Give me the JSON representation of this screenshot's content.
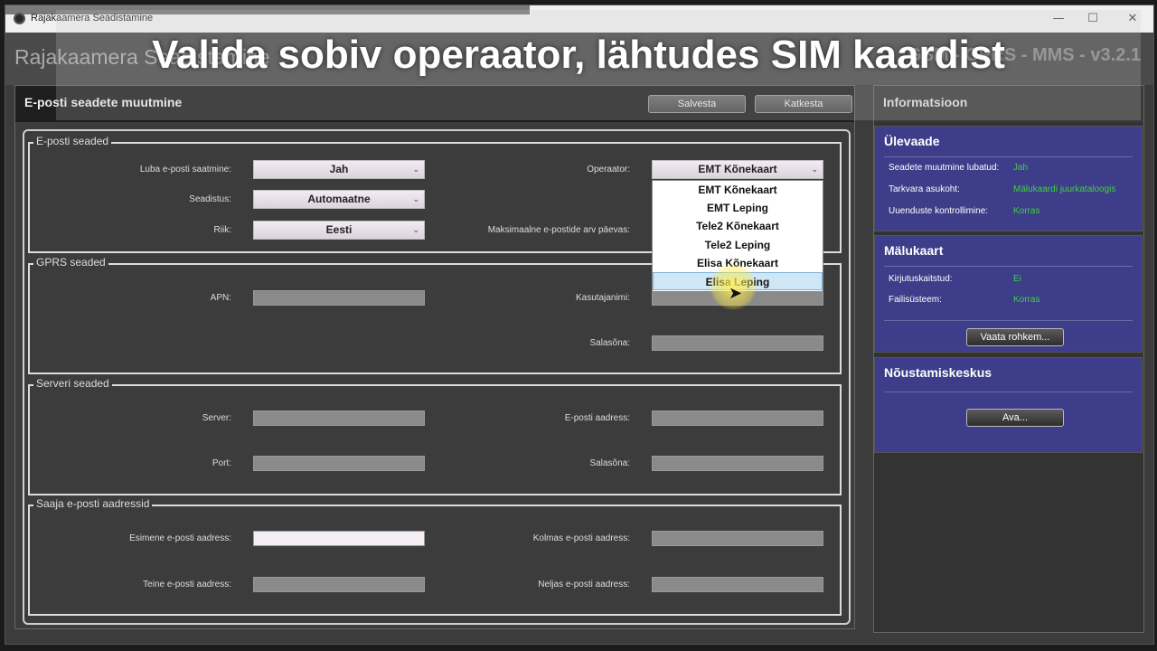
{
  "window": {
    "title": "Rajakaamera Seadistamine",
    "minimize": "—",
    "maximize": "☐",
    "close": "✕"
  },
  "header": {
    "app_title": "Rajakaamera Seadistamine",
    "version": "GSM - GPRS - MMS - v3.2.1"
  },
  "caption": "Valida sobiv operaator, lähtudes SIM kaardist",
  "email_panel": {
    "title": "E-posti seadete muutmine",
    "save_label": "Salvesta",
    "cancel_label": "Katkesta",
    "email_group": {
      "legend": "E-posti seaded",
      "enable_label": "Luba e-posti saatmine:",
      "enable_value": "Jah",
      "setup_label": "Seadistus:",
      "setup_value": "Automaatne",
      "country_label": "Riik:",
      "country_value": "Eesti",
      "operator_label": "Operaator:",
      "operator_value": "EMT Kõnekaart",
      "max_label": "Maksimaalne e-postide arv päevas:"
    },
    "operator_options": [
      "EMT Kõnekaart",
      "EMT Leping",
      "Tele2 Kõnekaart",
      "Tele2 Leping",
      "Elisa Kõnekaart",
      "Elisa Leping"
    ],
    "gprs_group": {
      "legend": "GPRS seaded",
      "apn_label": "APN:",
      "user_label": "Kasutajanimi:",
      "password_label": "Salasõna:"
    },
    "server_group": {
      "legend": "Serveri seaded",
      "server_label": "Server:",
      "email_label": "E-posti aadress:",
      "port_label": "Port:",
      "password_label": "Salasõna:"
    },
    "recipients_group": {
      "legend": "Saaja e-posti aadressid",
      "first_label": "Esimene e-posti aadress:",
      "third_label": "Kolmas e-posti aadress:",
      "second_label": "Teine e-posti aadress:",
      "fourth_label": "Neljas e-posti aadress:"
    }
  },
  "info_panel": {
    "title": "Informatsioon",
    "overview": {
      "heading": "Ülevaade",
      "rows": [
        {
          "label": "Seadete muutmine lubatud:",
          "value": "Jah"
        },
        {
          "label": "Tarkvara asukoht:",
          "value": "Mälukaardi juurkataloogis"
        },
        {
          "label": "Uuenduste kontrollimine:",
          "value": "Korras"
        }
      ]
    },
    "memory": {
      "heading": "Mälukaart",
      "rows": [
        {
          "label": "Kirjutuskaitstud:",
          "value": "Ei"
        },
        {
          "label": "Failisüsteem:",
          "value": "Korras"
        }
      ],
      "button": "Vaata rohkem..."
    },
    "support": {
      "heading": "Nõustamiskeskus",
      "button": "Ava..."
    }
  },
  "colors": {
    "accent_value": "#3fd23f",
    "info_bg": "#3d3d8a"
  }
}
